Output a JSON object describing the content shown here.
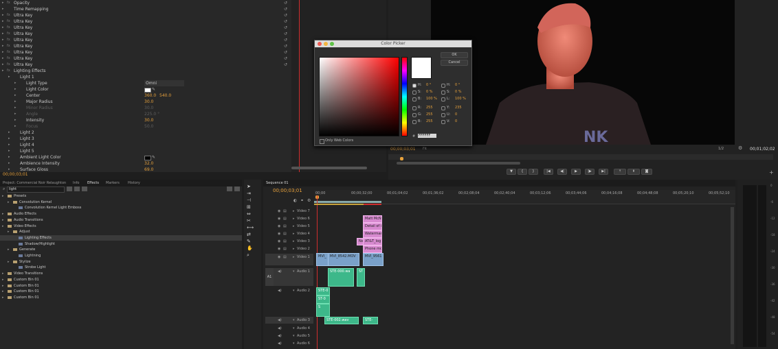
{
  "effect_controls": {
    "rows": [
      {
        "label": "Opacity",
        "indent": 0,
        "fx": true
      },
      {
        "label": "Time Remapping",
        "indent": 0,
        "fx": false
      },
      {
        "label": "Ultra Key",
        "indent": 0,
        "fx": true
      },
      {
        "label": "Ultra Key",
        "indent": 0,
        "fx": true
      },
      {
        "label": "Ultra Key",
        "indent": 0,
        "fx": true
      },
      {
        "label": "Ultra Key",
        "indent": 0,
        "fx": true
      },
      {
        "label": "Ultra Key",
        "indent": 0,
        "fx": true
      },
      {
        "label": "Ultra Key",
        "indent": 0,
        "fx": true
      },
      {
        "label": "Ultra Key",
        "indent": 0,
        "fx": true
      },
      {
        "label": "Ultra Key",
        "indent": 0,
        "fx": true
      },
      {
        "label": "Ultra Key",
        "indent": 0,
        "fx": true
      },
      {
        "label": "Lighting Effects",
        "indent": 0,
        "fx": true
      },
      {
        "label": "Light 1",
        "indent": 1,
        "fx": false
      },
      {
        "label": "Light Type",
        "indent": 2,
        "fx": false,
        "value": "Omni",
        "dropdown": true
      },
      {
        "label": "Light Color",
        "indent": 2,
        "fx": false,
        "swatch": "#ffffff"
      },
      {
        "label": "Center",
        "indent": 2,
        "fx": false,
        "value": "360.0",
        "value2": "540.0"
      },
      {
        "label": "Major Radius",
        "indent": 2,
        "fx": false,
        "value": "30.0"
      },
      {
        "label": "Minor Radius",
        "indent": 2,
        "fx": false,
        "value": "30.0",
        "dim": true
      },
      {
        "label": "Angle",
        "indent": 2,
        "fx": false,
        "value": "225.0 °",
        "dim": true
      },
      {
        "label": "Intensity",
        "indent": 2,
        "fx": false,
        "value": "30.0"
      },
      {
        "label": "Focus",
        "indent": 2,
        "fx": false,
        "value": "50.0",
        "dim": true
      },
      {
        "label": "Light 2",
        "indent": 1,
        "fx": false
      },
      {
        "label": "Light 3",
        "indent": 1,
        "fx": false
      },
      {
        "label": "Light 4",
        "indent": 1,
        "fx": false
      },
      {
        "label": "Light 5",
        "indent": 1,
        "fx": false
      },
      {
        "label": "Ambient Light Color",
        "indent": 1,
        "fx": false,
        "swatch": "#000000"
      },
      {
        "label": "Ambience Intensity",
        "indent": 1,
        "fx": false,
        "value": "32.0"
      },
      {
        "label": "Surface Gloss",
        "indent": 1,
        "fx": false,
        "value": "69.0"
      }
    ],
    "timecode": "00;00;03;01"
  },
  "color_picker": {
    "title": "Color Picker",
    "ok": "OK",
    "cancel": "Cancel",
    "only_web_colors": "Only Web Colors",
    "hex": "FFFFFF",
    "fields_left": [
      {
        "label": "H:",
        "value": "0 °"
      },
      {
        "label": "S:",
        "value": "0 %"
      },
      {
        "label": "B:",
        "value": "100 %"
      },
      {
        "label": "R:",
        "value": "255"
      },
      {
        "label": "G:",
        "value": "255"
      },
      {
        "label": "B:",
        "value": "255"
      }
    ],
    "fields_right": [
      {
        "label": "H:",
        "value": "0 °"
      },
      {
        "label": "S:",
        "value": "0 %"
      },
      {
        "label": "L:",
        "value": "100 %"
      },
      {
        "label": "Y:",
        "value": "235"
      },
      {
        "label": "U:",
        "value": "0"
      },
      {
        "label": "V:",
        "value": "0"
      }
    ]
  },
  "program_monitor": {
    "timecode": "00;00;03;01",
    "fit": "Fit",
    "zoom": "1/2",
    "duration": "00;01;02;02"
  },
  "project_panel": {
    "tabs": [
      "Project: Commercial Noir Relaughton",
      "Info",
      "Effects",
      "Markers",
      "History"
    ],
    "active_tab": "Effects",
    "search": "light",
    "tree": [
      {
        "label": "Presets",
        "indent": 0,
        "folder": true
      },
      {
        "label": "Convolution Kernel",
        "indent": 1,
        "folder": true
      },
      {
        "label": "Convolution Kernel Light Emboss",
        "indent": 2,
        "folder": false
      },
      {
        "label": "Audio Effects",
        "indent": 0,
        "folder": true
      },
      {
        "label": "Audio Transitions",
        "indent": 0,
        "folder": true
      },
      {
        "label": "Video Effects",
        "indent": 0,
        "folder": true
      },
      {
        "label": "Adjust",
        "indent": 1,
        "folder": true
      },
      {
        "label": "Lighting Effects",
        "indent": 2,
        "folder": false,
        "selected": true
      },
      {
        "label": "Shadow/Highlight",
        "indent": 2,
        "folder": false
      },
      {
        "label": "Generate",
        "indent": 1,
        "folder": true
      },
      {
        "label": "Lightning",
        "indent": 2,
        "folder": false
      },
      {
        "label": "Stylize",
        "indent": 1,
        "folder": true
      },
      {
        "label": "Strobe Light",
        "indent": 2,
        "folder": false
      },
      {
        "label": "Video Transitions",
        "indent": 0,
        "folder": true
      },
      {
        "label": "Custom Bin 01",
        "indent": 0,
        "folder": true
      },
      {
        "label": "Custom Bin 01",
        "indent": 0,
        "folder": true
      },
      {
        "label": "Custom Bin 01",
        "indent": 0,
        "folder": true
      },
      {
        "label": "Custom Bin 01",
        "indent": 0,
        "folder": true
      }
    ]
  },
  "timeline": {
    "tab": "Sequence 01",
    "timecode": "00;00;03;01",
    "ruler": [
      "00;00",
      "00;00;32;00",
      "00;01;04;02",
      "00;01;36;02",
      "00;02;08;04",
      "00;02;40;04",
      "00;03;12;06",
      "00;03;44;06",
      "00;04;16;08",
      "00;04;48;08",
      "00;05;20;10",
      "00;05;52;10"
    ],
    "video_tracks": [
      "Video 7",
      "Video 6",
      "Video 5",
      "Video 4",
      "Video 3",
      "Video 2",
      "Video 1"
    ],
    "audio_tracks": [
      "Audio 1",
      "Audio 2",
      "Audio 3",
      "Audio 4",
      "Audio 5",
      "Audio 6"
    ],
    "source_label": "A1",
    "clips": {
      "v6": "Matt McN",
      "v5": "Detail of i",
      "v4": "Watermark",
      "v3a": "Ne",
      "v3b": "AT&T_log",
      "v2": "Phone mo",
      "v1a": "MVI_",
      "v1b": "MVI_8542.MOV",
      "v1c": "MVI_9561",
      "a1a": "STE-000.wa",
      "a1b": "ST",
      "a2a": "STE-0",
      "a2b": "ST-0",
      "a2c": "S",
      "a3a": "STE-002.wav",
      "a3b": "STE-"
    }
  },
  "meter_ticks": [
    "0",
    "-6",
    "-12",
    "-18",
    "-24",
    "-30",
    "-36",
    "-42",
    "-48",
    "-54"
  ],
  "colors": {
    "accent": "#e8a23c",
    "playhead": "#d12e2e"
  }
}
